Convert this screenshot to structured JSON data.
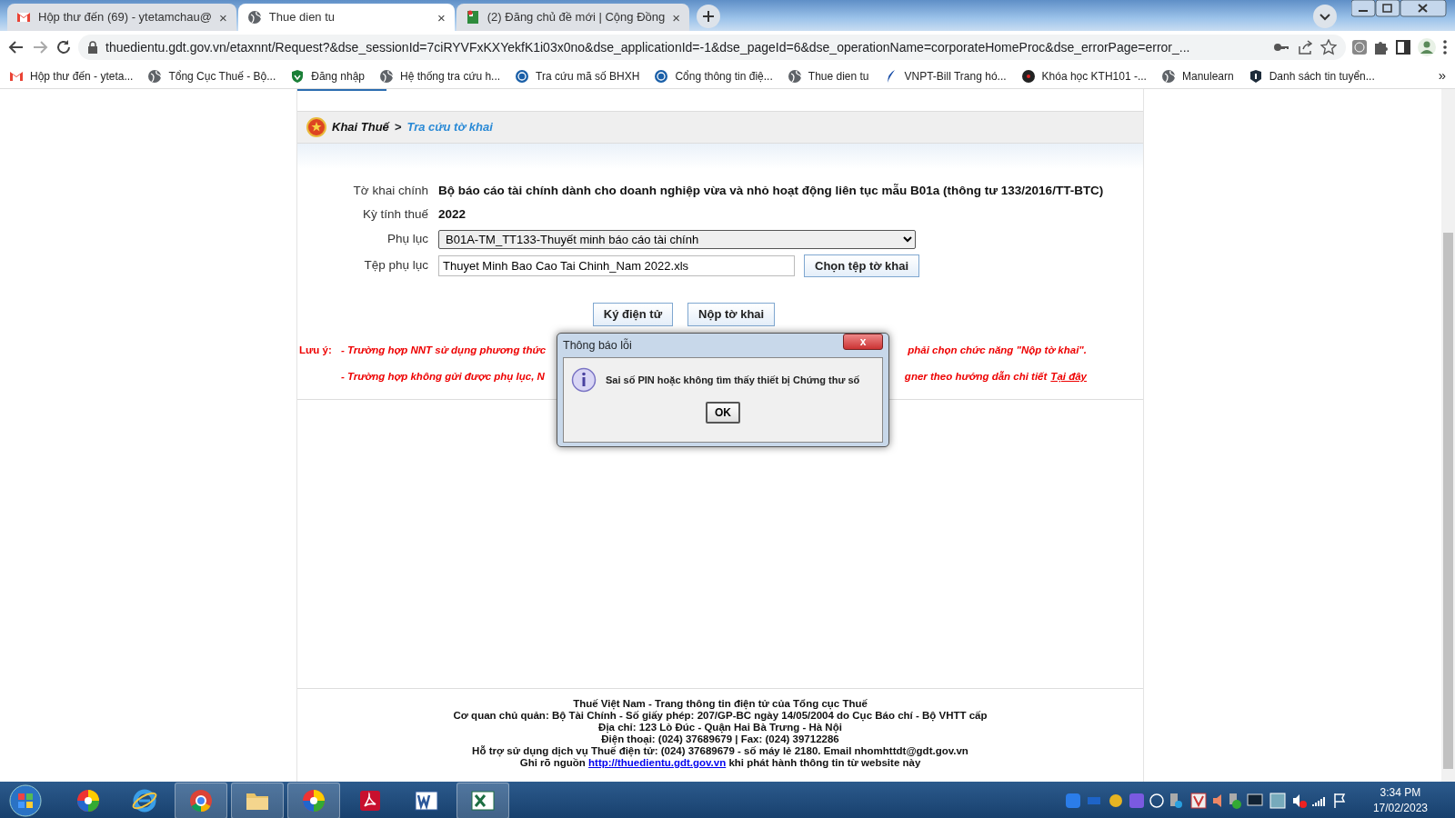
{
  "browser": {
    "tabs": [
      {
        "title": "Hộp thư đến (69) - ytetamchau@",
        "selected": false,
        "close": "×"
      },
      {
        "title": "Thue dien tu",
        "selected": true,
        "close": "×"
      },
      {
        "title": "(2) Đăng chủ đề mới | Cộng Đồng",
        "selected": false,
        "close": "×"
      }
    ],
    "address": "thuedientu.gdt.gov.vn/etaxnnt/Request?&dse_sessionId=7ciRYVFxKXYekfK1i03x0no&dse_applicationId=-1&dse_pageId=6&dse_operationName=corporateHomeProc&dse_errorPage=error_...",
    "bookmarks": [
      {
        "title": "Hộp thư đến - yteta..."
      },
      {
        "title": "Tổng Cục Thuế - Bộ..."
      },
      {
        "title": "Đăng nhập"
      },
      {
        "title": "Hệ thống tra cứu h..."
      },
      {
        "title": "Tra cứu mã số BHXH"
      },
      {
        "title": "Cổng thông tin điệ..."
      },
      {
        "title": "Thue dien tu"
      },
      {
        "title": "VNPT-Bill Trang hó..."
      },
      {
        "title": "Khóa học KTH101 -..."
      },
      {
        "title": "Manulearn"
      },
      {
        "title": "Danh sách tin tuyển..."
      }
    ],
    "bookmarks_more": "»"
  },
  "page": {
    "breadcrumb": {
      "root": "Khai Thuế",
      "separator": ">",
      "current": "Tra cứu tờ khai"
    },
    "fields": [
      {
        "label": "Tờ khai chính",
        "kind": "bold",
        "value": "Bộ báo cáo tài chính dành cho doanh nghiệp vừa và nhỏ hoạt động liên tục mẫu B01a (thông tư 133/2016/TT-BTC)"
      },
      {
        "label": "Kỳ tính thuế",
        "kind": "bold",
        "value": "2022"
      },
      {
        "label": "Phụ lục",
        "kind": "select",
        "value": "B01A-TM_TT133-Thuyết minh báo cáo tài chính"
      },
      {
        "label": "Tệp phụ lục",
        "kind": "file",
        "value": "Thuyet Minh Bao Cao Tai Chinh_Nam 2022.xls",
        "button": "Chọn tệp tờ khai"
      }
    ],
    "actions": [
      "Ký điện tử",
      "Nộp tờ khai"
    ],
    "note": {
      "label": "Lưu ý:",
      "lines": [
        {
          "left": "- Trường hợp NNT sử dụng phương thức",
          "right": "phải chọn chức năng \"Nộp tờ khai\"."
        },
        {
          "left": "- Trường hợp không gửi được phụ lục, N",
          "right": "gner theo hướng dẫn chi tiết",
          "link": "Tại đây"
        }
      ]
    },
    "footer": [
      "Thuế Việt Nam - Trang thông tin điện tử của Tổng cục Thuế",
      "Cơ quan chủ quản: Bộ Tài Chính - Số giấy phép: 207/GP-BC ngày 14/05/2004 do Cục Báo chí - Bộ VHTT cấp",
      "Địa chỉ: 123 Lò Đúc - Quận Hai Bà Trưng - Hà Nội",
      "Điện thoại: (024) 37689679 | Fax: (024) 39712286",
      "Hỗ trợ sử dụng dịch vụ Thuế điện tử: (024) 37689679 - số máy lẻ 2180. Email nhomhttdt@gdt.gov.vn"
    ],
    "footer_source": {
      "before": "Ghi rõ nguồn",
      "link": "http://thuedientu.gdt.gov.vn",
      "after": "khi phát hành thông tin từ website này"
    }
  },
  "dialog": {
    "title": "Thông báo lỗi",
    "close": "x",
    "message": "Sai số PIN hoặc không tìm thấy thiết bị Chứng thư số",
    "ok": "OK"
  },
  "taskbar": {
    "apps": [
      {
        "active": false
      },
      {
        "active": false
      },
      {
        "active": true
      },
      {
        "active": true
      },
      {
        "active": true
      },
      {
        "active": false
      },
      {
        "active": false
      },
      {
        "active": true
      }
    ],
    "time": "3:34 PM",
    "date": "17/02/2023"
  }
}
